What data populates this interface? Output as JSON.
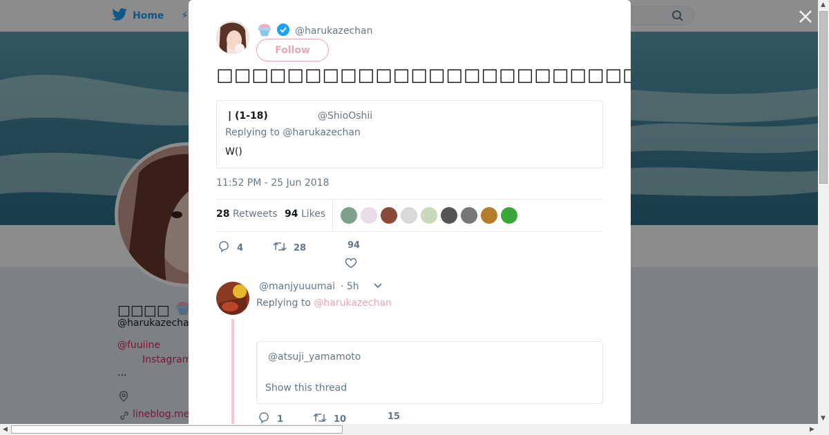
{
  "background": {
    "nav": {
      "home_label": "Home",
      "moments_stub": "⚡"
    },
    "profile": {
      "name": "□□□□",
      "handle": "@harukazechan",
      "link1": "@fuuiine",
      "link2": "Instagram",
      "bio_more": "...",
      "blog": "lineblog.me"
    }
  },
  "tweet": {
    "author_handle": "@harukazechan",
    "follow_label": "Follow",
    "text": "□□□□□□□□□□□□□□□□□□□□□□□□□□□□□□□□□□□□□□□□□□□□□□□□□□□□□□□□□□□□□□□□□□□□□□□",
    "quote": {
      "name": "| (1-18)",
      "handle": "@ShioOshii",
      "replying_to": "Replying to @harukazechan",
      "text": "W()"
    },
    "timestamp": "11:52 PM - 25 Jun 2018",
    "retweets_count": "28",
    "retweets_label": "Retweets",
    "likes_count": "94",
    "likes_label": "Likes",
    "actions": {
      "replies": "4",
      "retweets": "28",
      "likes": "94"
    }
  },
  "reply": {
    "handle": "@manjyuuumai",
    "time": "· 5h",
    "replying_label": "Replying to",
    "replying_handle": "@harukazechan",
    "mention": "@atsuji_yamamoto",
    "show_thread": "Show this thread",
    "actions": {
      "replies": "1",
      "retweets": "10",
      "likes": "15"
    }
  },
  "colors": {
    "accent_pink": "#e8a5b4",
    "twitter_blue": "#1da1f2",
    "verified_blue": "#1da1f2",
    "muted_text": "#657786"
  }
}
